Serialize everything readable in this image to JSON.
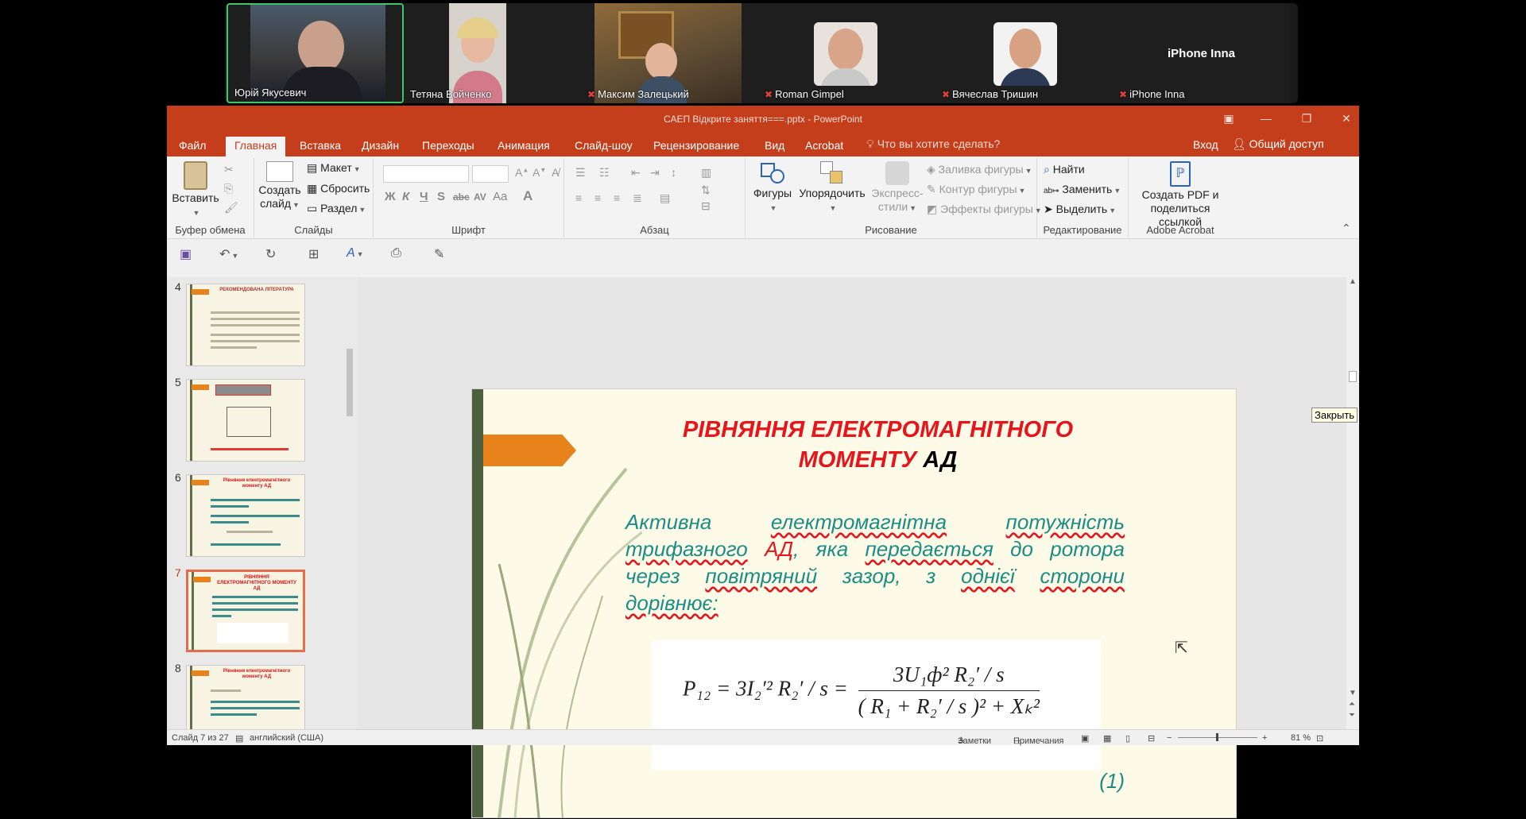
{
  "participants": [
    {
      "name": "Юрій Якусевич",
      "muted": false,
      "active": true
    },
    {
      "name": "Тетяна Войченко",
      "muted": false,
      "active": false
    },
    {
      "name": "Максим Залецький",
      "muted": true,
      "active": false
    },
    {
      "name": "Roman Gimpel",
      "muted": true,
      "active": false
    },
    {
      "name": "Вячеслав Тришин",
      "muted": true,
      "active": false
    },
    {
      "name": "iPhone Inna",
      "muted": true,
      "active": false,
      "big_label": "iPhone Inna"
    }
  ],
  "window": {
    "title": "САЕП Відкрите заняття===.pptx - PowerPoint"
  },
  "tabs": [
    "Файл",
    "Главная",
    "Вставка",
    "Дизайн",
    "Переходы",
    "Анимация",
    "Слайд-шоу",
    "Рецензирование",
    "Вид",
    "Acrobat"
  ],
  "active_tab": "Главная",
  "tell_me": "Что вы хотите сделать?",
  "account": {
    "login": "Вход",
    "share": "Общий доступ"
  },
  "ribbon": {
    "clipboard": {
      "paste": "Вставить",
      "label": "Буфер обмена"
    },
    "slides": {
      "new_slide_1": "Создать",
      "new_slide_2": "слайд",
      "layout": "Макет",
      "reset": "Сбросить",
      "section": "Раздел",
      "label": "Слайды"
    },
    "font": {
      "label": "Шрифт",
      "bold": "Ж",
      "italic": "К",
      "underline": "Ч",
      "shadow": "S",
      "strike": "abc",
      "aa": "Aa",
      "color": "A"
    },
    "paragraph": {
      "label": "Абзац"
    },
    "drawing": {
      "shapes": "Фигуры",
      "arrange": "Упорядочить",
      "styles_1": "Экспресс-",
      "styles_2": "стили",
      "fill": "Заливка фигуры",
      "outline": "Контур фигуры",
      "effects": "Эффекты фигуры",
      "label": "Рисование"
    },
    "editing": {
      "find": "Найти",
      "replace": "Заменить",
      "select": "Выделить",
      "label": "Редактирование"
    },
    "acrobat": {
      "create_1": "Создать PDF и",
      "create_2": "поделиться ссылкой",
      "label": "Adobe Acrobat"
    }
  },
  "thumbnails": [
    {
      "num": "4",
      "title": "РЕКОМЕНДОВАНА ЛІТЕРАТУРА"
    },
    {
      "num": "5",
      "title": ""
    },
    {
      "num": "6",
      "title": "Рівняння електромагнітного моменту АД"
    },
    {
      "num": "7",
      "title": "РІВНЯННЯ ЕЛЕКТРОМАГНІТНОГО МОМЕНТУ АД"
    },
    {
      "num": "8",
      "title": "Рівняння електромагнітного моменту АД"
    }
  ],
  "selected_slide": "7",
  "slide": {
    "title_line1": "РІВНЯННЯ ЕЛЕКТРОМАГНІТНОГО",
    "title_line2_red": "МОМЕНТУ",
    "title_line2_black": "АД",
    "body": {
      "w1": "Активна",
      "w2": "електромагнітна",
      "w3": "потужність",
      "w4": "трифазного",
      "w5": "АД",
      "w6": ", яка",
      "w7": "передається",
      "w8": "до ротора через",
      "w9": "повітряний",
      "w10": "зазор, з",
      "w11": "однієї",
      "w12": "сторони",
      "w13": "дорівнює:"
    },
    "formula": {
      "lhs": "P₁₂ = 3I₂′² R₂′ / s =",
      "numerator": "3U₁ф² R₂′ / s",
      "denominator": "( R₁ + R₂′ / s )² + Xₖ²"
    },
    "eq_number": "(1)"
  },
  "tooltip": "Закрыть",
  "status": {
    "slide_count": "Слайд 7 из 27",
    "language": "английский (США)",
    "notes": "Заметки",
    "comments": "Примечания",
    "zoom": "81 %"
  }
}
